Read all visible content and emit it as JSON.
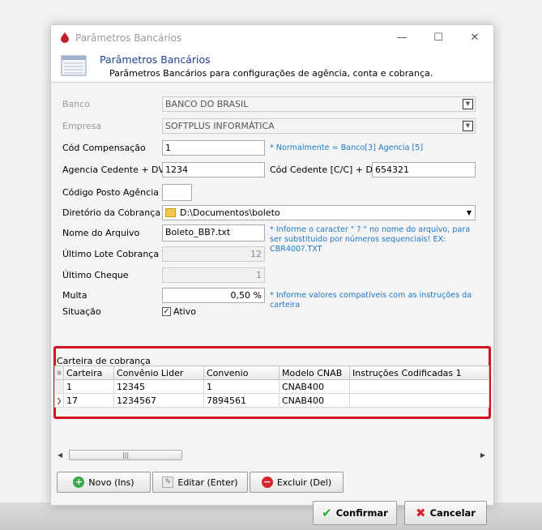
{
  "window": {
    "title": "Parâmetros Bancários",
    "minimize": "—",
    "maximize": "☐",
    "close": "✕"
  },
  "header": {
    "title": "Parâmetros Bancários",
    "subtitle": "Parâmetros Bancários para configurações de agência, conta e cobrança."
  },
  "form": {
    "banco_label": "Banco",
    "banco_value": "BANCO DO BRASIL",
    "empresa_label": "Empresa",
    "empresa_value": "SOFTPLUS INFORMÁTICA",
    "cod_comp_label": "Cód Compensação",
    "cod_comp_value": "1",
    "cod_comp_hint": "* Normalmente  = Banco[3] Agencia [5]",
    "agencia_label": "Agencia Cedente + DV",
    "agencia_value": "1234",
    "cod_cedente_label": "Cód Cedente [C/C] + DV",
    "cod_cedente_value": "654321",
    "posto_label": "Código Posto Agência",
    "posto_value": "",
    "diretorio_label": "Diretório da Cobrança",
    "diretorio_value": "D:\\Documentos\\boleto",
    "arquivo_label": "Nome do Arquivo",
    "arquivo_value": "Boleto_BB?.txt",
    "arquivo_hint": "* Informe o caracter \" ? \" no nome do arquivo, para ser substituido por números sequenciais! EX: CBR400?.TXT",
    "lote_label": "Último Lote Cobrança",
    "lote_value": "12",
    "cheque_label": "Último Cheque",
    "cheque_value": "1",
    "multa_label": "Multa",
    "multa_value": "0,50 %",
    "multa_hint": "* Informe valores compatíveis com as instruções da carteira",
    "situacao_label": "Situação",
    "ativo_label": "Ativo",
    "ativo_check": "✓"
  },
  "grid": {
    "caption": "Carteira de cobrança",
    "indicator_header": "※",
    "columns": [
      "Carteira",
      "Convênio Lider",
      "Convenio",
      "Modelo CNAB",
      "Instruções Codificadas 1"
    ],
    "rows": [
      {
        "indicator": "",
        "cells": [
          "1",
          "12345",
          "1",
          "CNAB400",
          ""
        ]
      },
      {
        "indicator": "❯",
        "cells": [
          "17",
          "1234567",
          "7894561",
          "CNAB400",
          ""
        ]
      }
    ]
  },
  "scroll": {
    "left": "◀",
    "right": "▶",
    "grip": "|||"
  },
  "buttons": {
    "novo": "Novo (Ins)",
    "editar": "Editar (Enter)",
    "excluir": "Excluir (Del)",
    "confirmar": "Confirmar",
    "cancelar": "Cancelar",
    "plus": "+",
    "minus": "−",
    "check": "✔",
    "x": "✖",
    "dropdown": "▼"
  },
  "colors": {
    "header_title": "#1f3f8f",
    "hint": "#1e78c8",
    "highlight_border": "#d2141c"
  }
}
